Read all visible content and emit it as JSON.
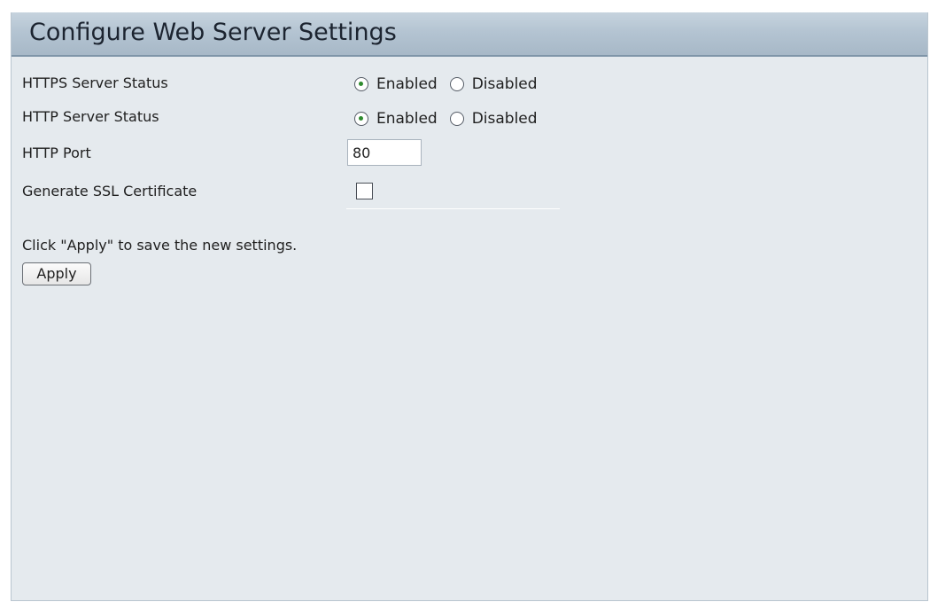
{
  "header": {
    "title": "Configure Web Server Settings"
  },
  "settings": {
    "https_status": {
      "label": "HTTPS Server Status",
      "options": [
        "Enabled",
        "Disabled"
      ],
      "selected": "Enabled"
    },
    "http_status": {
      "label": "HTTP Server Status",
      "options": [
        "Enabled",
        "Disabled"
      ],
      "selected": "Enabled"
    },
    "http_port": {
      "label": "HTTP Port",
      "value": "80"
    },
    "ssl_certificate": {
      "label": "Generate SSL Certificate",
      "checked": false
    }
  },
  "footer": {
    "hint": "Click \"Apply\" to save the new settings.",
    "apply_label": "Apply"
  },
  "colors": {
    "panel_background": "#e5eaee",
    "header_background": "#b4c4d2",
    "radio_selected": "#2e8b2e"
  }
}
